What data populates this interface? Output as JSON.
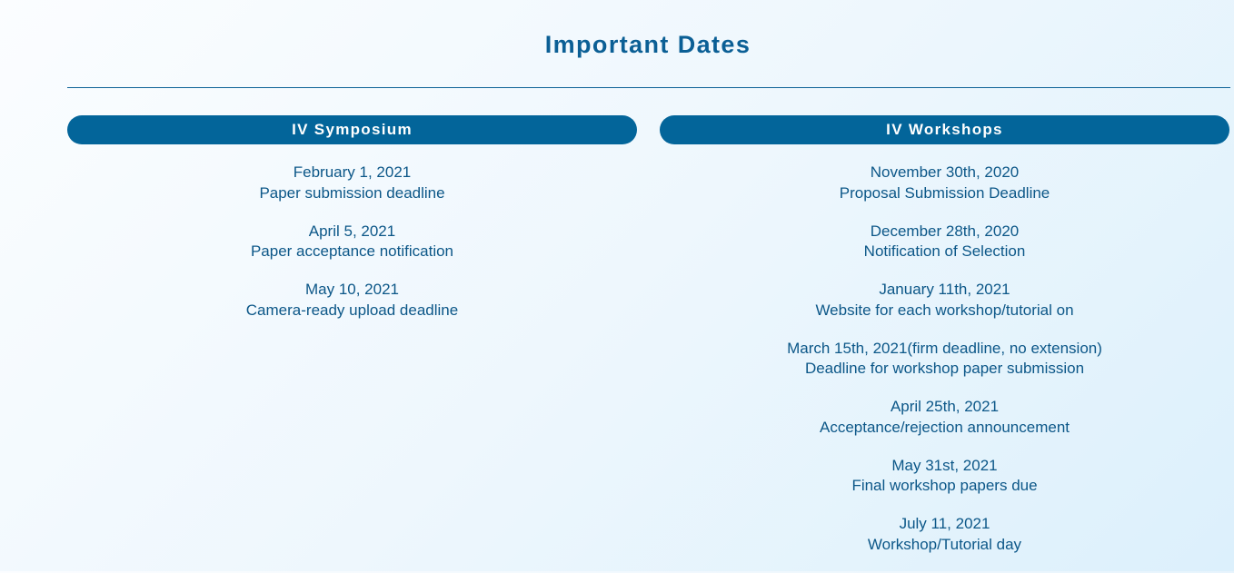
{
  "header": {
    "title": "Important Dates"
  },
  "columns": [
    {
      "heading": "IV Symposium",
      "items": [
        {
          "date": "February 1, 2021",
          "label": "Paper submission deadline"
        },
        {
          "date": "April 5, 2021",
          "label": "Paper acceptance notification"
        },
        {
          "date": "May 10, 2021",
          "label": "Camera-ready upload deadline"
        }
      ]
    },
    {
      "heading": "IV Workshops",
      "items": [
        {
          "date": "November 30th, 2020",
          "label": "Proposal Submission Deadline"
        },
        {
          "date": "December 28th, 2020",
          "label": "Notification of Selection"
        },
        {
          "date": "January 11th, 2021",
          "label": "Website for each workshop/tutorial on"
        },
        {
          "date": "March 15th, 2021(firm deadline, no extension)",
          "label": "Deadline for workshop paper submission"
        },
        {
          "date": "April 25th, 2021",
          "label": "Acceptance/rejection announcement"
        },
        {
          "date": "May 31st, 2021",
          "label": "Final workshop papers due"
        },
        {
          "date": "July 11, 2021",
          "label": "Workshop/Tutorial day"
        }
      ]
    }
  ],
  "colors": {
    "accent": "#03659a",
    "text": "#0c5788",
    "rule": "#0d6296"
  }
}
